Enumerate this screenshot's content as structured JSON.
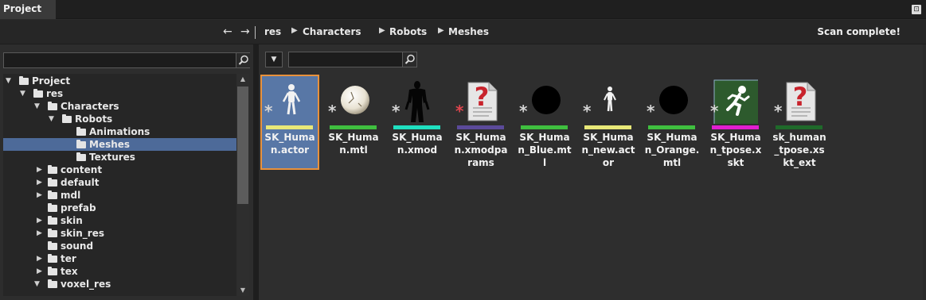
{
  "window": {
    "tab_title": "Project",
    "pin_icon": "pin-icon"
  },
  "breadcrumb": {
    "items": [
      "res",
      "Characters",
      "Robots",
      "Meshes"
    ],
    "status": "Scan complete!"
  },
  "left_search": {
    "value": "",
    "placeholder": ""
  },
  "right_search": {
    "value": "",
    "placeholder": ""
  },
  "tree": [
    {
      "label": "Project",
      "depth": 0,
      "expanded": true
    },
    {
      "label": "res",
      "depth": 1,
      "expanded": true
    },
    {
      "label": "Characters",
      "depth": 2,
      "expanded": true
    },
    {
      "label": "Robots",
      "depth": 3,
      "expanded": true
    },
    {
      "label": "Animations",
      "depth": 4
    },
    {
      "label": "Meshes",
      "depth": 4,
      "selected": true
    },
    {
      "label": "Textures",
      "depth": 4
    },
    {
      "label": "content",
      "depth": 2,
      "expanded": false
    },
    {
      "label": "default",
      "depth": 2,
      "expanded": false
    },
    {
      "label": "mdl",
      "depth": 2,
      "expanded": false
    },
    {
      "label": "prefab",
      "depth": 2
    },
    {
      "label": "skin",
      "depth": 2,
      "expanded": false
    },
    {
      "label": "skin_res",
      "depth": 2,
      "expanded": false
    },
    {
      "label": "sound",
      "depth": 2
    },
    {
      "label": "ter",
      "depth": 2,
      "expanded": false
    },
    {
      "label": "tex",
      "depth": 2,
      "expanded": false
    },
    {
      "label": "voxel_res",
      "depth": 2,
      "expanded": true
    }
  ],
  "assets": [
    {
      "name": "SK_Human.actor",
      "icon": "human-figure-icon",
      "type_color": "#e8e878",
      "selected": true
    },
    {
      "name": "SK_Human.mtl",
      "icon": "material-sphere-icon",
      "type_color": "#3fbf3f"
    },
    {
      "name": "SK_Human.xmod",
      "icon": "robot-model-icon",
      "type_color": "#1fe0c0"
    },
    {
      "name": "SK_Human.xmodparams",
      "icon": "unknown-file-icon",
      "type_color": "#5b4a9a",
      "red_star": true
    },
    {
      "name": "SK_Human_Blue.mtl",
      "icon": "material-sphere-icon",
      "type_color": "#3fbf3f"
    },
    {
      "name": "SK_Human_new.actor",
      "icon": "human-figure-icon",
      "type_color": "#e8e878"
    },
    {
      "name": "SK_Human_Orange.mtl",
      "icon": "material-sphere-icon",
      "type_color": "#3fbf3f"
    },
    {
      "name": "SK_Human_tpose.xskt",
      "icon": "running-man-icon",
      "type_color": "#e01fcf"
    },
    {
      "name": "sk_human_tpose.xskt_ext",
      "icon": "unknown-file-icon",
      "type_color": "#1f6a2a"
    }
  ],
  "colors": {
    "selection": "#4d6a99",
    "asset_selection": "#5877a6",
    "asset_outline": "#e8913c"
  }
}
